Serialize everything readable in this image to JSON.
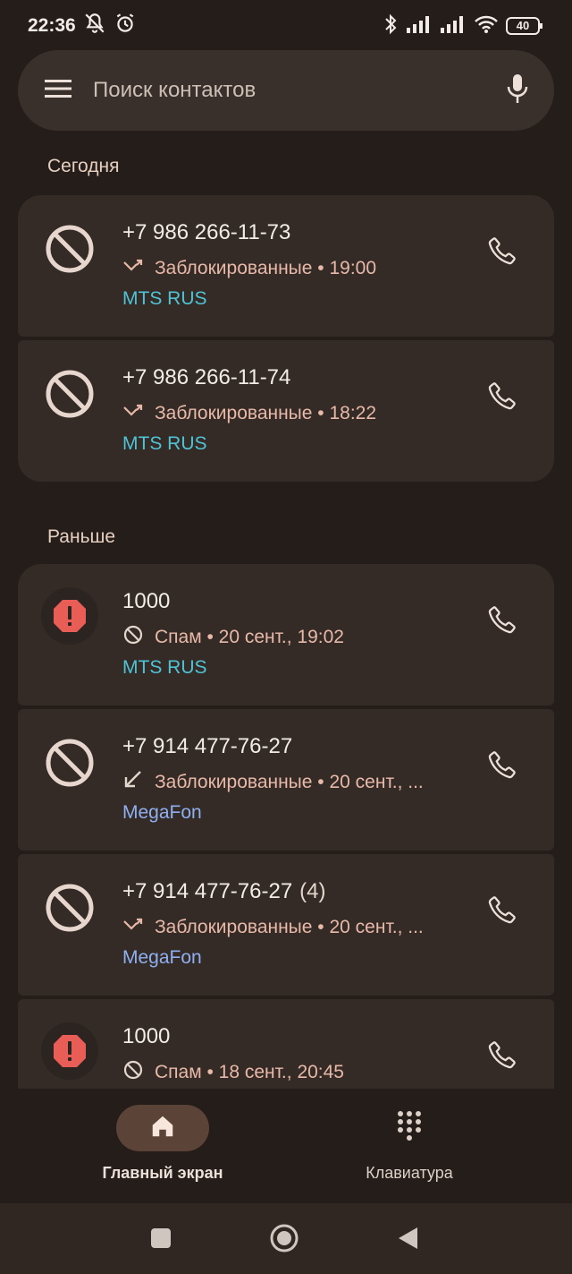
{
  "status_bar": {
    "time": "22:36",
    "battery": "40",
    "icons": [
      "notifications-off-icon",
      "alarm-icon",
      "bluetooth-icon",
      "signal-icon",
      "signal-icon",
      "wifi-icon",
      "battery-icon"
    ]
  },
  "search": {
    "placeholder": "Поиск контактов",
    "menu_icon": "menu-icon",
    "mic_icon": "mic-icon"
  },
  "sections": {
    "today": "Сегодня",
    "earlier": "Раньше"
  },
  "today_calls": [
    {
      "number": "+7 986 266-11-73",
      "status": "Заблокированные • 19:00",
      "carrier": "MTS RUS",
      "type": "blocked",
      "direction_icon": "missed-call-icon"
    },
    {
      "number": "+7 986 266-11-74",
      "status": "Заблокированные • 18:22",
      "carrier": "MTS RUS",
      "type": "blocked",
      "direction_icon": "missed-call-icon"
    }
  ],
  "earlier_calls": [
    {
      "number": "1000",
      "count": "",
      "status": "Спам • 20 сент., 19:02",
      "carrier": "MTS RUS",
      "type": "spam",
      "direction_icon": "block-small-icon"
    },
    {
      "number": "+7 914 477-76-27",
      "count": "",
      "status": "Заблокированные • 20 сент., ...",
      "carrier": "MegaFon",
      "type": "blocked",
      "direction_icon": "incoming-call-icon"
    },
    {
      "number": "+7 914 477-76-27",
      "count": "(4)",
      "status": "Заблокированные • 20 сент., ...",
      "carrier": "MegaFon",
      "type": "blocked",
      "direction_icon": "missed-call-icon"
    },
    {
      "number": "1000",
      "count": "",
      "status": "Спам • 18 сент., 20:45",
      "carrier": "",
      "type": "spam",
      "direction_icon": "block-small-icon"
    }
  ],
  "carrier_colors": {
    "MTS RUS": "#4fc3d6",
    "MegaFon": "#8fb0f0"
  },
  "bottom_nav": {
    "home": "Главный экран",
    "keypad": "Клавиатура"
  },
  "system_nav": [
    "recents-icon",
    "home-circle-icon",
    "back-icon"
  ]
}
